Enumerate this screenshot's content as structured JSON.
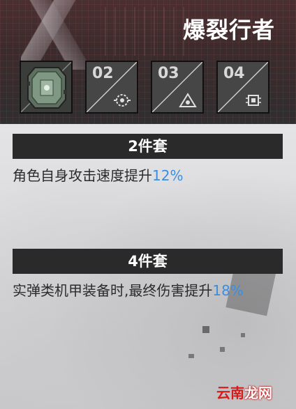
{
  "header": {
    "title": "爆裂行者",
    "slots": [
      {
        "num": "",
        "icon": "chip-module-icon",
        "active": true
      },
      {
        "num": "02",
        "icon": "gear-eye-icon"
      },
      {
        "num": "03",
        "icon": "triangle-eye-icon"
      },
      {
        "num": "04",
        "icon": "processor-icon"
      }
    ]
  },
  "bonus2": {
    "heading": "2件套",
    "text": "角色自身攻击速度提升",
    "value": "12%"
  },
  "bonus4": {
    "heading": "4件套",
    "text": "实弹类机甲装备时,最终伤害提升",
    "value": "18%"
  },
  "watermark": {
    "part1": "云南",
    "part2": "龙网"
  }
}
